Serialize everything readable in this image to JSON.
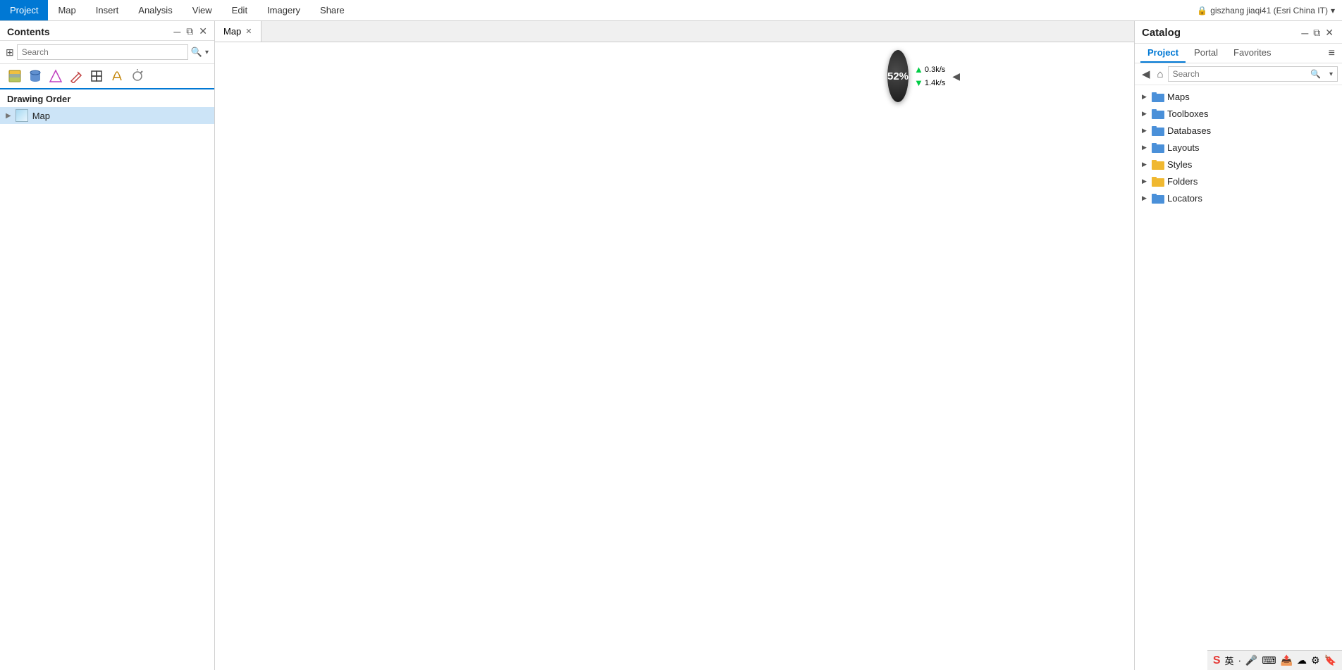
{
  "ribbon": {
    "tabs": [
      {
        "id": "project",
        "label": "Project",
        "active": true
      },
      {
        "id": "map",
        "label": "Map"
      },
      {
        "id": "insert",
        "label": "Insert"
      },
      {
        "id": "analysis",
        "label": "Analysis"
      },
      {
        "id": "view",
        "label": "View"
      },
      {
        "id": "edit",
        "label": "Edit"
      },
      {
        "id": "imagery",
        "label": "Imagery"
      },
      {
        "id": "share",
        "label": "Share"
      }
    ],
    "user": "giszhang jiaqi41 (Esri China IT)"
  },
  "contents": {
    "title": "Contents",
    "search_placeholder": "Search",
    "drawing_order_label": "Drawing Order",
    "layers": [
      {
        "name": "Map",
        "selected": true
      }
    ]
  },
  "map_tab": {
    "label": "Map"
  },
  "performance": {
    "percent": "52%",
    "upload": "0.3k/s",
    "download": "1.4k/s"
  },
  "catalog": {
    "title": "Catalog",
    "tabs": [
      {
        "id": "project",
        "label": "Project",
        "active": true
      },
      {
        "id": "portal",
        "label": "Portal"
      },
      {
        "id": "favorites",
        "label": "Favorites"
      }
    ],
    "search_placeholder": "Search",
    "tree_items": [
      {
        "id": "maps",
        "label": "Maps",
        "icon": "folder-blue"
      },
      {
        "id": "toolboxes",
        "label": "Toolboxes",
        "icon": "folder-blue"
      },
      {
        "id": "databases",
        "label": "Databases",
        "icon": "folder-blue"
      },
      {
        "id": "layouts",
        "label": "Layouts",
        "icon": "folder-blue"
      },
      {
        "id": "styles",
        "label": "Styles",
        "icon": "folder-yellow"
      },
      {
        "id": "folders",
        "label": "Folders",
        "icon": "folder-yellow"
      },
      {
        "id": "locators",
        "label": "Locators",
        "icon": "folder-blue"
      }
    ]
  }
}
